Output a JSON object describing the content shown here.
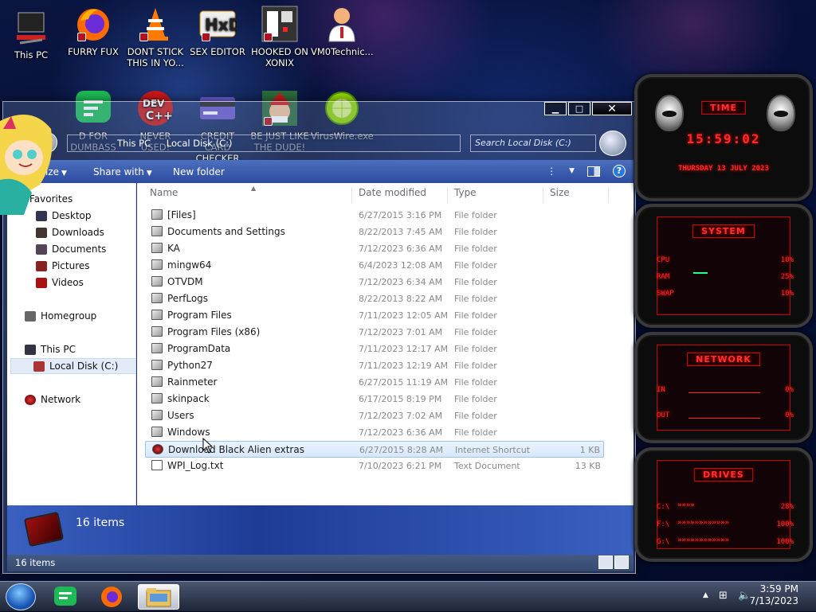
{
  "desktop": {
    "icons": [
      {
        "label_l1": "This PC",
        "label_l2": "",
        "icon": "computer-icon"
      },
      {
        "label_l1": "FURRY FUX",
        "label_l2": "",
        "icon": "firefox-icon"
      },
      {
        "label_l1": "DONT STICK",
        "label_l2": "THIS IN YO...",
        "icon": "vlc-cone-icon"
      },
      {
        "label_l1": "SEX EDITOR",
        "label_l2": "",
        "icon": "hex-editor-icon"
      },
      {
        "label_l1": "HOOKED ON",
        "label_l2": "XONIX",
        "icon": "xonix-game-icon"
      },
      {
        "label_l1": "VM0Technic...",
        "label_l2": "",
        "icon": "doctor-icon"
      },
      {
        "label_l1": "D FOR",
        "label_l2": "DUMBASS",
        "icon": "discord-like-green-icon"
      },
      {
        "label_l1": "NEVER USED!",
        "label_l2": "",
        "icon": "devcpp-icon"
      },
      {
        "label_l1": "CREDIT CARD",
        "label_l2": "CHECKER",
        "icon": "credit-card-icon"
      },
      {
        "label_l1": "BE JUST LIKE",
        "label_l2": "THE DUDE!",
        "icon": "santa-elf-icon"
      },
      {
        "label_l1": "VirusWire.exe",
        "label_l2": "",
        "icon": "lime-icon"
      }
    ]
  },
  "explorer": {
    "breadcrumb": [
      "This PC",
      "Local Disk (C:)"
    ],
    "search_placeholder": "Search Local Disk (C:)",
    "toolbar": {
      "organize": "ize",
      "share_with": "Share with",
      "new_folder": "New folder"
    },
    "nav": {
      "favorites": "Favorites",
      "desktop": "Desktop",
      "downloads": "Downloads",
      "documents": "Documents",
      "pictures": "Pictures",
      "videos": "Videos",
      "homegroup": "Homegroup",
      "this_pc": "This PC",
      "local_disk": "Local Disk (C:)",
      "network": "Network"
    },
    "columns": {
      "name": "Name",
      "date": "Date modified",
      "type": "Type",
      "size": "Size"
    },
    "files": [
      {
        "name": "[Files]",
        "date": "6/27/2015 3:16 PM",
        "type": "File folder",
        "size": ""
      },
      {
        "name": "Documents and Settings",
        "date": "8/22/2013 7:45 AM",
        "type": "File folder",
        "size": ""
      },
      {
        "name": "KA",
        "date": "7/12/2023 6:36 AM",
        "type": "File folder",
        "size": ""
      },
      {
        "name": "mingw64",
        "date": "6/4/2023 12:08 AM",
        "type": "File folder",
        "size": ""
      },
      {
        "name": "OTVDM",
        "date": "7/12/2023 6:34 AM",
        "type": "File folder",
        "size": ""
      },
      {
        "name": "PerfLogs",
        "date": "8/22/2013 8:22 AM",
        "type": "File folder",
        "size": ""
      },
      {
        "name": "Program Files",
        "date": "7/11/2023 12:05 AM",
        "type": "File folder",
        "size": ""
      },
      {
        "name": "Program Files (x86)",
        "date": "7/12/2023 7:01 AM",
        "type": "File folder",
        "size": ""
      },
      {
        "name": "ProgramData",
        "date": "7/11/2023 12:17 AM",
        "type": "File folder",
        "size": ""
      },
      {
        "name": "Python27",
        "date": "7/11/2023 12:19 AM",
        "type": "File folder",
        "size": ""
      },
      {
        "name": "Rainmeter",
        "date": "6/27/2015 11:19 AM",
        "type": "File folder",
        "size": ""
      },
      {
        "name": "skinpack",
        "date": "6/17/2015 8:19 PM",
        "type": "File folder",
        "size": ""
      },
      {
        "name": "Users",
        "date": "7/12/2023 7:02 AM",
        "type": "File folder",
        "size": ""
      },
      {
        "name": "Windows",
        "date": "7/12/2023 6:36 AM",
        "type": "File folder",
        "size": ""
      },
      {
        "name": "Download Black Alien extras",
        "date": "6/27/2015 8:28 AM",
        "type": "Internet Shortcut",
        "size": "1 KB"
      },
      {
        "name": "WPI_Log.txt",
        "date": "7/10/2023 6:21 PM",
        "type": "Text Document",
        "size": "13 KB"
      }
    ],
    "selected_index": 14,
    "details_count": "16 items",
    "status_count": "16 items"
  },
  "widgets": {
    "time": {
      "title": "TIME",
      "clock": "15:59:02",
      "date": "THURSDAY 13 JULY 2023"
    },
    "system": {
      "title": "SYSTEM",
      "cpu_label": "CPU",
      "cpu_val": "10%",
      "ram_label": "RAM",
      "ram_val": "25%",
      "swap_label": "SWAP",
      "swap_val": "10%"
    },
    "network": {
      "title": "NETWORK",
      "in_label": "IN",
      "in_val": "0%",
      "out_label": "OUT",
      "out_val": "0%"
    },
    "drives": {
      "title": "DRIVES",
      "d1": "C:\\",
      "d1v": "28%",
      "d2": "F:\\",
      "d2v": "100%",
      "d3": "G:\\",
      "d3v": "100%"
    }
  },
  "taskbar": {
    "time": "3:59 PM",
    "date": "7/13/2023"
  },
  "colors": {
    "accent_red": "#ff2a2a",
    "toolbar_blue": "#3b5bb0",
    "selection": "#d7e8fb"
  }
}
